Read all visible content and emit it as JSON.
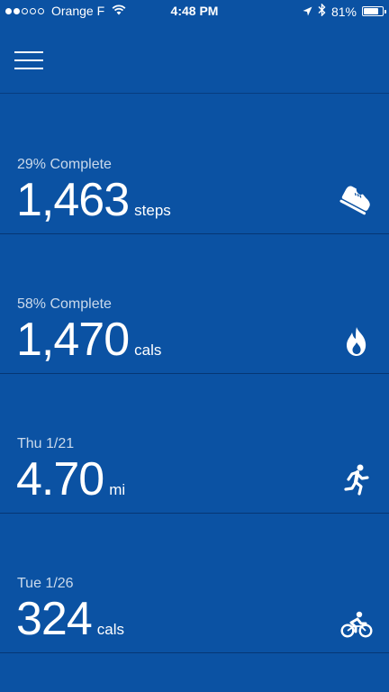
{
  "status_bar": {
    "carrier": "Orange F",
    "time": "4:48 PM",
    "battery": "81%",
    "battery_level": 0.81,
    "signal_bars_filled": 2,
    "signal_bars_total": 5
  },
  "header": {
    "menu_icon": "hamburger-menu-icon"
  },
  "tiles": [
    {
      "caption": "29% Complete",
      "value": "1,463",
      "unit": "steps",
      "icon": "shoe-icon"
    },
    {
      "caption": "58% Complete",
      "value": "1,470",
      "unit": "cals",
      "icon": "flame-icon"
    },
    {
      "caption": "Thu 1/21",
      "value": "4.70",
      "unit": "mi",
      "icon": "runner-icon"
    },
    {
      "caption": "Tue 1/26",
      "value": "324",
      "unit": "cals",
      "icon": "cyclist-icon"
    }
  ],
  "colors": {
    "background": "#0b52a3",
    "text": "#ffffff"
  }
}
